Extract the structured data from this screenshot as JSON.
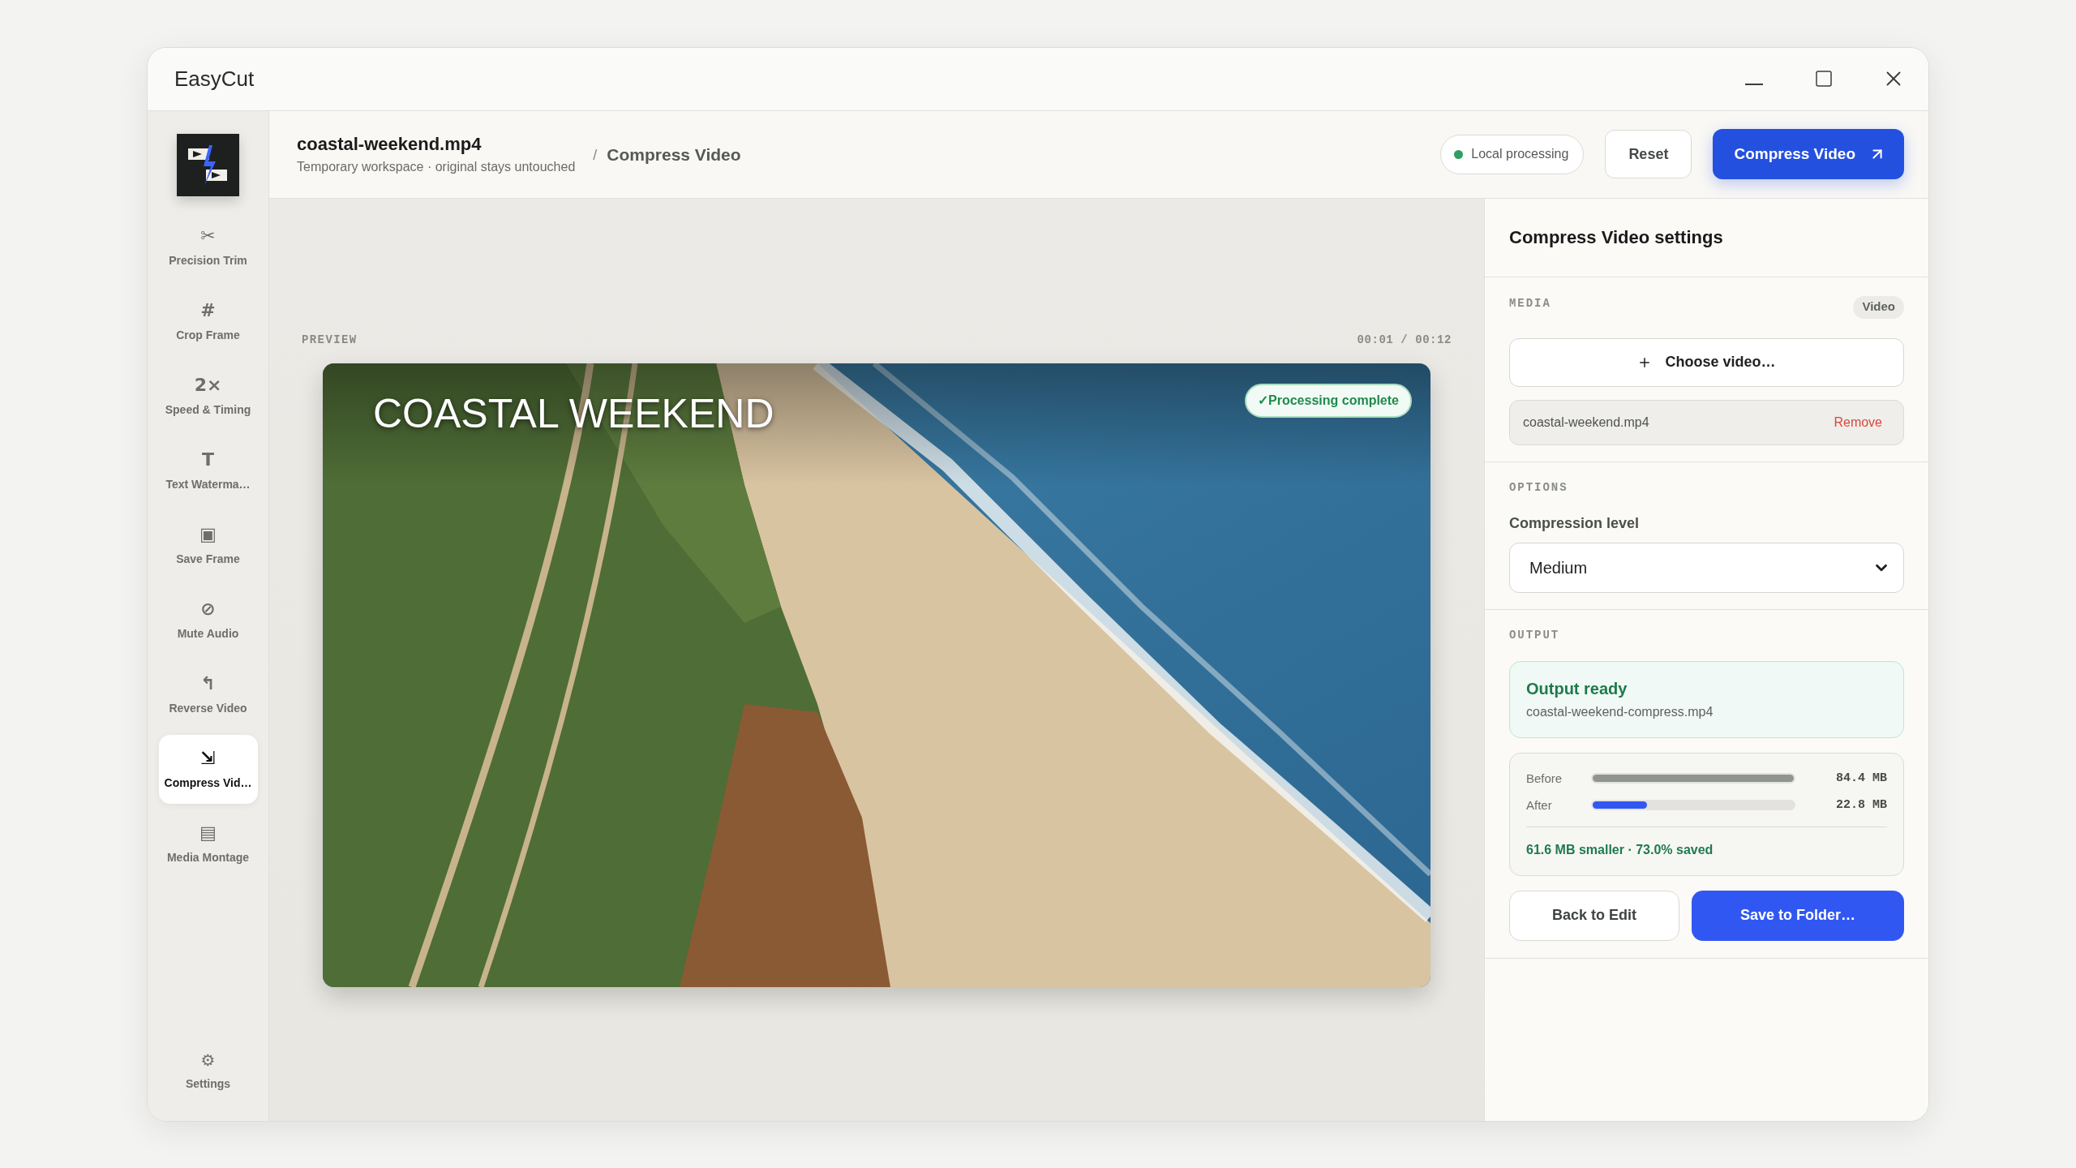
{
  "window": {
    "title": "EasyCut"
  },
  "sidebar": {
    "items": [
      {
        "glyph": "✂",
        "label": "Precision Trim",
        "selected": false
      },
      {
        "glyph": "#",
        "label": "Crop Frame",
        "selected": false
      },
      {
        "glyph": "2×",
        "label": "Speed & Timing",
        "selected": false
      },
      {
        "glyph": "T",
        "label": "Text Waterma…",
        "selected": false
      },
      {
        "glyph": "▣",
        "label": "Save Frame",
        "selected": false
      },
      {
        "glyph": "⊘",
        "label": "Mute Audio",
        "selected": false
      },
      {
        "glyph": "↰",
        "label": "Reverse Video",
        "selected": false
      },
      {
        "glyph": "⇲",
        "label": "Compress Vid…",
        "selected": true
      },
      {
        "glyph": "▤",
        "label": "Media Montage",
        "selected": false
      }
    ],
    "footer": {
      "glyph": "⚙",
      "label": "Settings"
    }
  },
  "header": {
    "file_name": "coastal-weekend.mp4",
    "subtitle": "Temporary workspace · original stays untouched",
    "separator": "/",
    "page": "Compress Video",
    "status": "Local processing",
    "buttons": [
      {
        "label": "Reset",
        "kind": "secondary"
      },
      {
        "label": "Compress Video",
        "kind": "primary"
      }
    ]
  },
  "preview": {
    "label": "PREVIEW",
    "time": "00:01 / 00:12",
    "overlay_title": "COASTAL WEEKEND",
    "badge": "✓Processing complete"
  },
  "settings": {
    "title": "Compress Video settings",
    "media": {
      "heading": "MEDIA",
      "badge": "Video",
      "choose_button": "Choose video…",
      "file": {
        "name": "coastal-weekend.mp4",
        "action": "Remove"
      }
    },
    "options": {
      "heading": "OPTIONS",
      "field_label": "Compression level",
      "value": "Medium"
    },
    "output": {
      "heading": "OUTPUT",
      "status": {
        "title": "Output ready",
        "file": "coastal-weekend-compress.mp4"
      },
      "sizes": [
        {
          "label": "Before",
          "kind": "original",
          "level": 1,
          "reading": "84.4 MB"
        },
        {
          "label": "After",
          "kind": "result",
          "level": 0.27,
          "reading": "22.8 MB"
        }
      ],
      "summary": "61.6 MB smaller · 73.0% saved",
      "buttons": [
        {
          "label": "Back to Edit",
          "kind": "secondary"
        },
        {
          "label": "Save to Folder…",
          "kind": "primary"
        }
      ]
    }
  }
}
